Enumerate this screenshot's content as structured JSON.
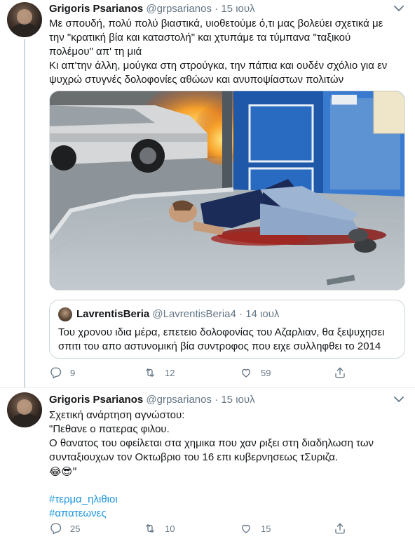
{
  "tweets": [
    {
      "name": "Grigoris Psarianos",
      "handle": "@grpsarianos",
      "separator": "·",
      "date": "15 ιουλ",
      "lines": [
        "Με σπουδή, πολύ πολύ βιαστικά, υιοθετούμε ό,τι μας βολεύει σχετικά με",
        "την \"κρατική βία και καταστολή\" και χτυπάμε τα τύμπανα \"ταξικού",
        "πολέμου\" απ' τη μιά",
        "Κι απ'την άλλη, μούγκα στη στρούγκα, την πάπια και ουδέν σχόλιο για εν",
        "ψυχρώ στυγνές δολοφονίες αθώων και ανυποψίαστων πολιτών"
      ],
      "quote": {
        "name": "LavrentisBeria",
        "handle": "@LavrentisBeria4",
        "separator": "·",
        "date": "14 ιουλ",
        "lines": [
          "Του χρονου ιδια μέρα, επετειο δολοφονίας του Αζαρλιαν, θα ξεψυχησει",
          "σπιτι του απο αστυνομική βία συντροφος που ειχε συλληφθει το 2014"
        ]
      },
      "stats": {
        "replies": "9",
        "retweets": "12",
        "likes": "59"
      }
    },
    {
      "name": "Grigoris Psarianos",
      "handle": "@grpsarianos",
      "separator": "·",
      "date": "15 ιουλ",
      "lines": [
        "Σχετική ανάρτηση αγνώστου:",
        "\"Πεθανε ο πατερας φιλου.",
        "Ο θανατος του οφείλεται στα χημικα που χαν ριξει στη διαδηλωση των",
        "συνταξιουχων τον Οκτωβριο του 16 επι κυβερνησεως τΣυριζα."
      ],
      "emoji_line": "😂😎\"",
      "hashtags": [
        "#τερμα_ηλιθιοι",
        "#απατεωνες"
      ],
      "stats": {
        "replies": "25",
        "retweets": "10",
        "likes": "15"
      }
    }
  ],
  "icons": {
    "reply": "reply-icon",
    "retweet": "retweet-icon",
    "like": "heart-icon",
    "share": "share-icon",
    "menu": "chevron-down-icon"
  },
  "colors": {
    "text": "#14171a",
    "muted": "#657786",
    "link": "#1b95e0",
    "border": "#ccd6dd"
  }
}
